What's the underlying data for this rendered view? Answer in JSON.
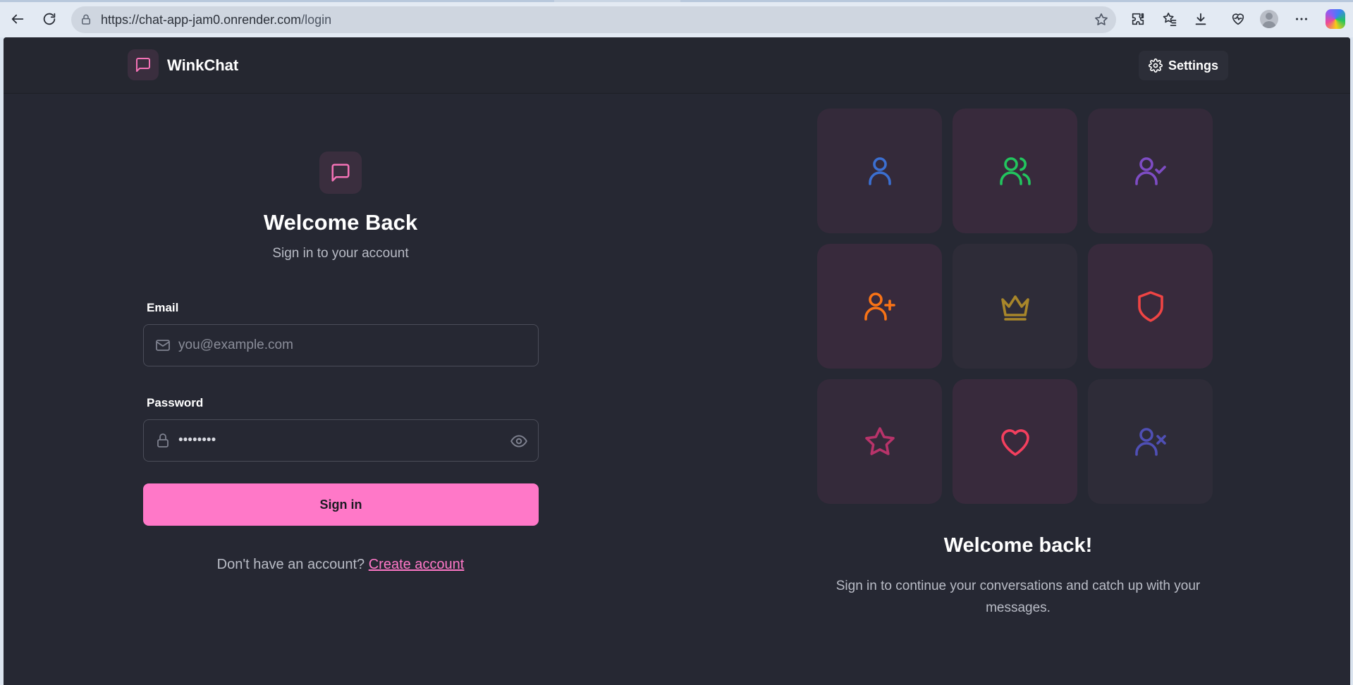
{
  "browser": {
    "url_main": "https://chat-app-jam0.onrender.com",
    "url_path": "/login"
  },
  "navbar": {
    "brand": "WinkChat",
    "settings_label": "Settings"
  },
  "login": {
    "title": "Welcome Back",
    "subtitle": "Sign in to your account",
    "email_label": "Email",
    "email_placeholder": "you@example.com",
    "password_label": "Password",
    "password_value": "password",
    "submit_label": "Sign in",
    "signup_prompt": "Don't have an account?",
    "signup_link": "Create account"
  },
  "showcase": {
    "tiles": [
      {
        "icon": "user-icon",
        "color": "#3b6fd1"
      },
      {
        "icon": "users-icon",
        "color": "#22c55e"
      },
      {
        "icon": "user-check-icon",
        "color": "#7e4cc4"
      },
      {
        "icon": "user-plus-icon",
        "color": "#f97316"
      },
      {
        "icon": "crown-icon",
        "color": "#a8862a"
      },
      {
        "icon": "shield-icon",
        "color": "#ef4444"
      },
      {
        "icon": "star-icon",
        "color": "#b8336a"
      },
      {
        "icon": "heart-icon",
        "color": "#f43f5e"
      },
      {
        "icon": "user-x-icon",
        "color": "#4f4fb5"
      }
    ],
    "title": "Welcome back!",
    "subtitle": "Sign in to continue your conversations and catch up with your messages."
  },
  "colors": {
    "accent": "#ff78c8",
    "background": "#262833"
  }
}
